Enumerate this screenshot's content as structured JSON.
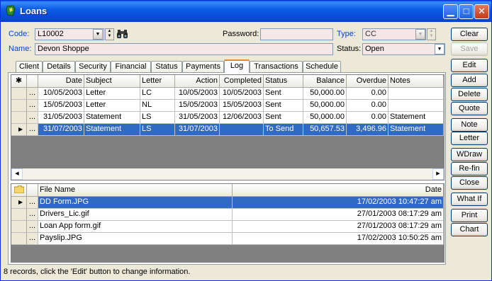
{
  "window": {
    "title": "Loans"
  },
  "form": {
    "code_label": "Code:",
    "code_value": "L10002",
    "name_label": "Name:",
    "name_value": "Devon Shoppe",
    "password_label": "Password:",
    "password_value": "",
    "type_label": "Type:",
    "type_value": "CC",
    "status_label": "Status:",
    "status_value": "Open"
  },
  "buttons": [
    "Clear",
    "Save",
    "Edit",
    "Add",
    "Delete",
    "Quote",
    "Note",
    "Letter",
    "WDraw",
    "Re-fin",
    "Close",
    "What If",
    "Print",
    "Chart"
  ],
  "tabs": [
    "Client",
    "Details",
    "Security",
    "Financial",
    "Status",
    "Payments",
    "Log",
    "Transactions",
    "Schedule"
  ],
  "active_tab": "Log",
  "log": {
    "star": "✱",
    "columns": [
      "Date",
      "Subject",
      "Letter",
      "Action",
      "Completed",
      "Status",
      "Balance",
      "Overdue",
      "Notes"
    ],
    "rows": [
      [
        "10/05/2003",
        "Letter",
        "LC",
        "10/05/2003",
        "10/05/2003",
        "Sent",
        "50,000.00",
        "0.00",
        ""
      ],
      [
        "15/05/2003",
        "Letter",
        "NL",
        "15/05/2003",
        "15/05/2003",
        "Sent",
        "50,000.00",
        "0.00",
        ""
      ],
      [
        "31/05/2003",
        "Statement",
        "LS",
        "31/05/2003",
        "12/06/2003",
        "Sent",
        "50,000.00",
        "0.00",
        "Statement"
      ],
      [
        "31/07/2003",
        "Statement",
        "LS",
        "31/07/2003",
        "",
        "To Send",
        "50,657.53",
        "3,496.96",
        "Statement"
      ]
    ],
    "dots": "..."
  },
  "files": {
    "columns": [
      "File Name",
      "Date"
    ],
    "rows": [
      [
        "DD Form.JPG",
        "17/02/2003 10:47:27 am"
      ],
      [
        "Drivers_Lic.gif",
        "27/01/2003 08:17:29 am"
      ],
      [
        "Loan App form.gif",
        "27/01/2003 08:17:29 am"
      ],
      [
        "Payslip.JPG",
        "17/02/2003 10:50:25 am"
      ]
    ]
  },
  "status_bar": "8 records, click the 'Edit' button to change information."
}
